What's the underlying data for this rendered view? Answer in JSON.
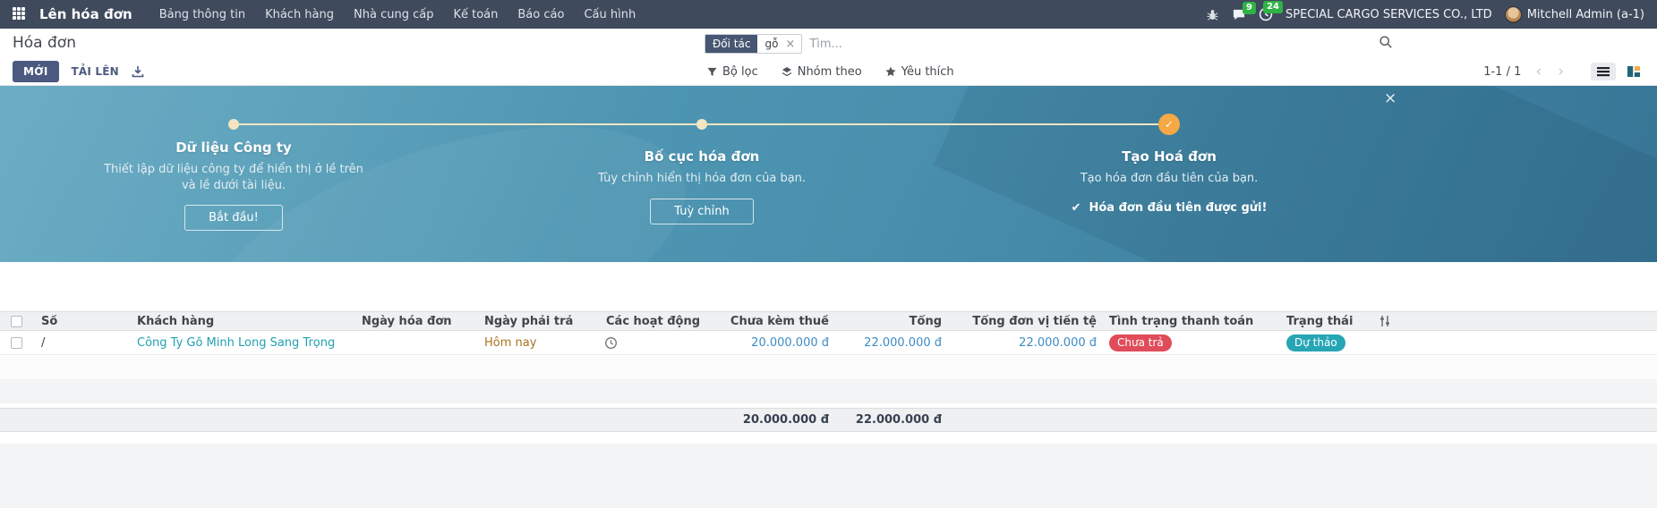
{
  "nav": {
    "app_name": "Lên hóa đơn",
    "menus": [
      "Bảng thông tin",
      "Khách hàng",
      "Nhà cung cấp",
      "Kế toán",
      "Báo cáo",
      "Cấu hình"
    ],
    "messages_badge": "9",
    "activities_badge": "24",
    "company": "SPECIAL CARGO SERVICES CO., LTD",
    "user": "Mitchell Admin (a-1)"
  },
  "control_panel": {
    "title": "Hóa đơn",
    "new_button": "MỚI",
    "upload_button": "TẢI LÊN",
    "search": {
      "facet_label": "Đối tác",
      "facet_value": "gỗ",
      "remove": "×",
      "placeholder": "Tìm..."
    },
    "menus": {
      "filters": "Bộ lọc",
      "group_by": "Nhóm theo",
      "favorites": "Yêu thích"
    },
    "pager": {
      "range": "1-1 / 1",
      "prev": "‹",
      "next": "›"
    }
  },
  "banner": {
    "close": "×",
    "steps": [
      {
        "title": "Dữ liệu Công ty",
        "subtitle": "Thiết lập dữ liệu công ty để hiển thị ở lề trên và lề dưới tài liệu.",
        "button": "Bắt đầu!"
      },
      {
        "title": "Bố cục hóa đơn",
        "subtitle": "Tùy chỉnh hiển thị hóa đơn của bạn.",
        "button": "Tuỳ chỉnh"
      },
      {
        "title": "Tạo Hoá đơn",
        "subtitle": "Tạo hóa đơn đầu tiên của bạn.",
        "done_check": "✔",
        "done_label": "Hóa đơn đầu tiên được gửi!"
      }
    ]
  },
  "table": {
    "headers": [
      "Số",
      "Khách hàng",
      "Ngày hóa đơn",
      "Ngày phải trả",
      "Các hoạt động",
      "Chưa kèm thuế",
      "Tổng",
      "Tổng đơn vị tiền tệ",
      "Tình trạng thanh toán",
      "Trạng thái"
    ],
    "rows": [
      {
        "so": "/",
        "khach_hang": "Công Ty Gỗ Minh Long Sang Trọng",
        "ngay_hoa_don": "",
        "ngay_phai_tra": "Hôm nay",
        "chua_kem_thue": "20.000.000 đ",
        "tong": "22.000.000 đ",
        "tong_don_vi_tien_te": "22.000.000 đ",
        "tinh_trang_thanh_toan": "Chưa trả",
        "trang_thai": "Dự thảo"
      }
    ],
    "footer": {
      "chua_kem_thue": "20.000.000 đ",
      "tong": "22.000.000 đ"
    }
  },
  "colors": {
    "navbar_bg": "#3f4a5c",
    "primary_button": "#4c5a80",
    "banner_gradient_start": "#59a2bc",
    "banner_gradient_end": "#3f81a3",
    "timeline": "#f3e5c3",
    "done_step_orange": "#f5a843",
    "badge_green": "#2fb344",
    "link_teal": "#21a1b1",
    "due_today": "#a8731e",
    "amount_blue": "#3d8cc4",
    "badge_unpaid_red": "#e04c59",
    "badge_draft_teal": "#26a5b5"
  },
  "icons": {
    "check": "✓"
  }
}
